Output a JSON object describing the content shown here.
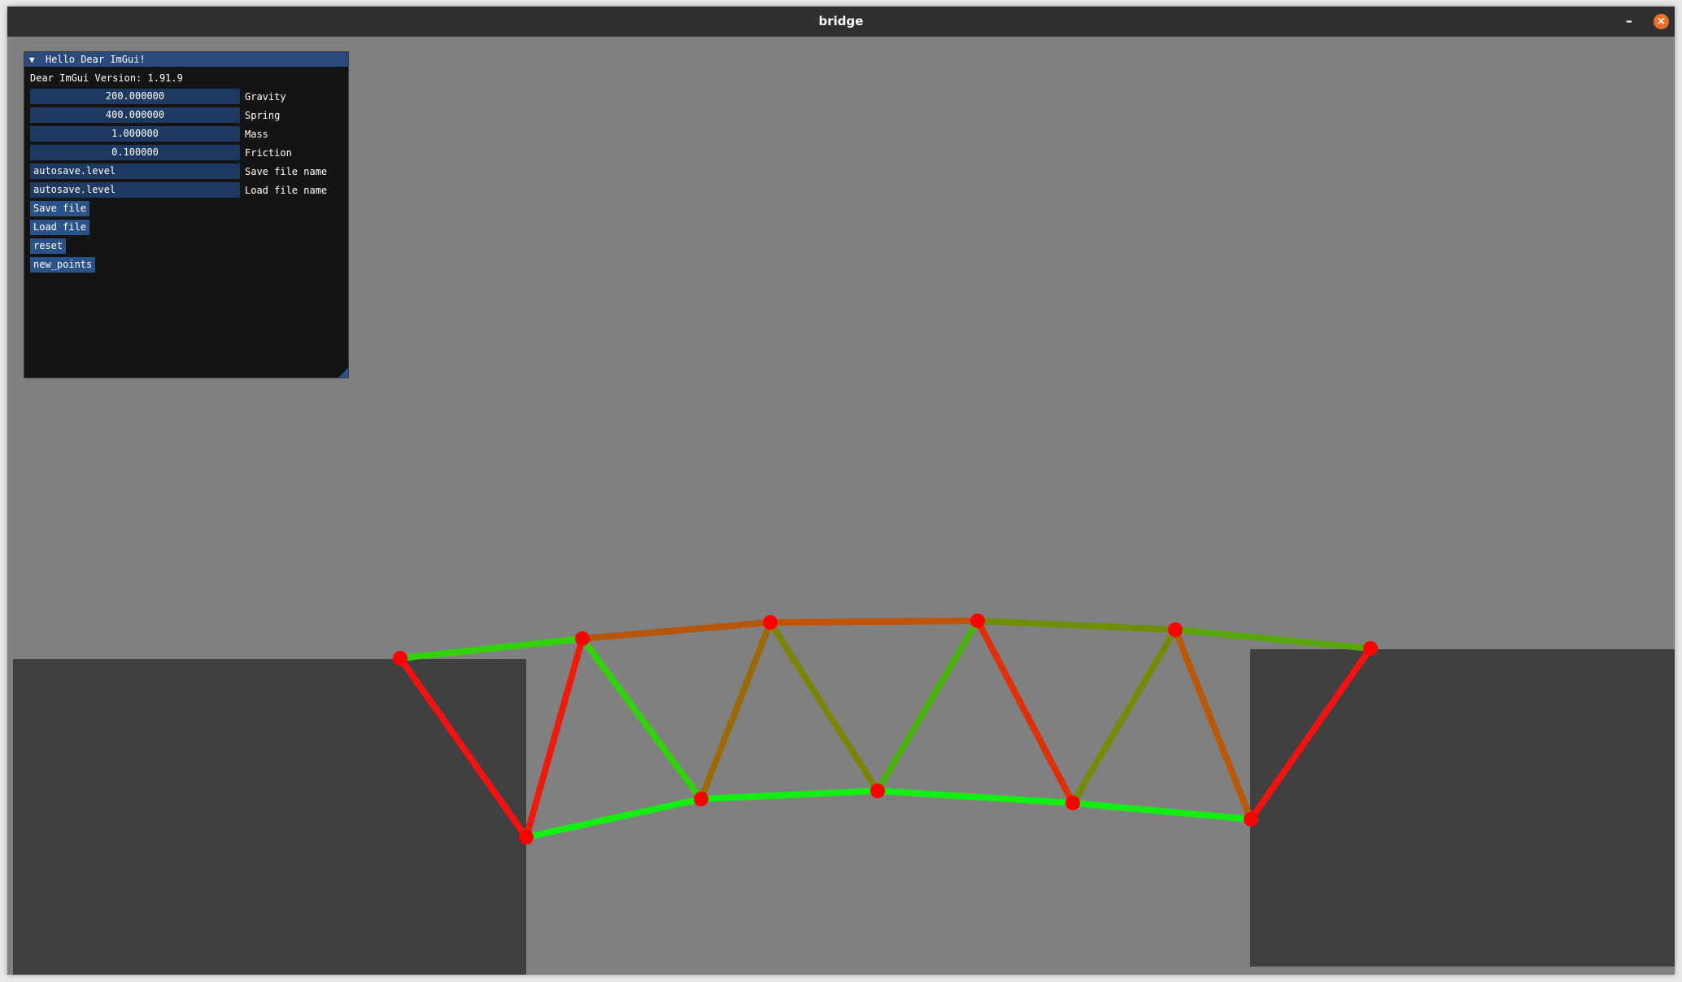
{
  "window": {
    "title": "bridge",
    "minimize_glyph": "–",
    "close_glyph": "×"
  },
  "panel": {
    "title": "Hello Dear ImGui!",
    "collapse_glyph": "▼",
    "version_text": "Dear ImGui Version: 1.91.9",
    "fields": [
      {
        "value": "200.000000",
        "label": "Gravity"
      },
      {
        "value": "400.000000",
        "label": "Spring"
      },
      {
        "value": "1.000000",
        "label": "Mass"
      },
      {
        "value": "0.100000",
        "label": "Friction"
      },
      {
        "value": "autosave.level",
        "label": "Save file name"
      },
      {
        "value": "autosave.level",
        "label": "Load file name"
      }
    ],
    "buttons": [
      "Save file",
      "Load file",
      "reset",
      "new_points"
    ]
  },
  "scene": {
    "background_color": "#808080",
    "ground_color": "#404040",
    "node_color": "#ff0000"
  }
}
